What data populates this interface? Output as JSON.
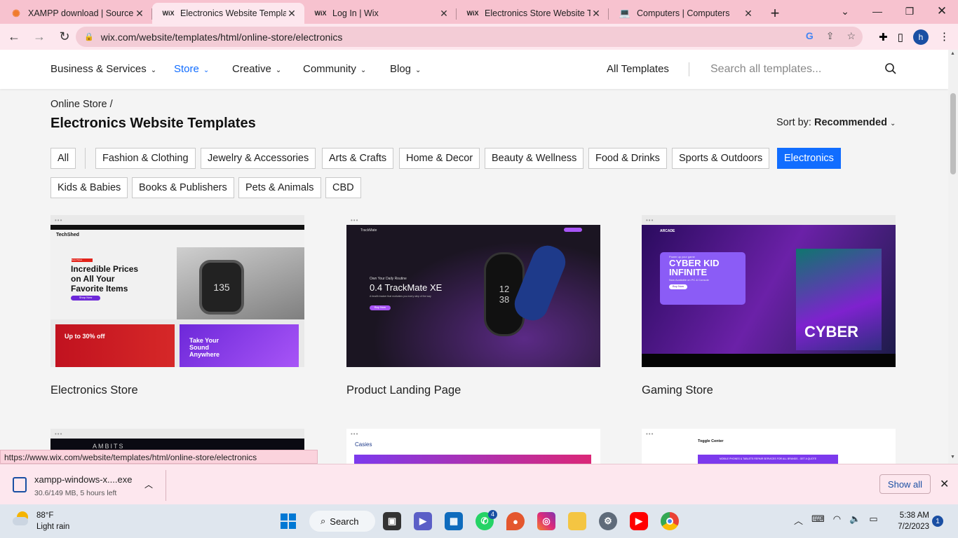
{
  "browser": {
    "tabs": [
      {
        "title": "XAMPP download | SourceFo",
        "favicon": "xampp-icon",
        "active": false
      },
      {
        "title": "Electronics Website Template",
        "favicon": "wix-icon",
        "active": true
      },
      {
        "title": "Log In | Wix",
        "favicon": "wix-icon",
        "active": false
      },
      {
        "title": "Electronics Store Website Ten",
        "favicon": "wix-icon",
        "active": false
      },
      {
        "title": "Computers | Computers",
        "favicon": "laptop-icon",
        "active": false
      }
    ],
    "url": "wix.com/website/templates/html/online-store/electronics",
    "profile_initial": "h",
    "status_url": "https://www.wix.com/website/templates/html/online-store/electronics"
  },
  "site_nav": {
    "items": [
      "Business & Services",
      "Store",
      "Creative",
      "Community",
      "Blog"
    ],
    "all_templates": "All Templates",
    "search_placeholder": "Search all templates..."
  },
  "page": {
    "breadcrumb": "Online Store /",
    "title": "Electronics Website Templates",
    "sort_label": "Sort by:",
    "sort_value": "Recommended"
  },
  "filters": {
    "row1": [
      "All",
      "Fashion & Clothing",
      "Jewelry & Accessories",
      "Arts & Crafts",
      "Home & Decor",
      "Beauty & Wellness",
      "Food & Drinks",
      "Sports & Outdoors",
      "Electronics"
    ],
    "row2": [
      "Kids & Babies",
      "Books & Publishers",
      "Pets & Animals",
      "CBD"
    ],
    "active": "Electronics"
  },
  "templates": [
    {
      "name": "Electronics Store",
      "brand": "TechShed",
      "headline": "Incredible Prices on All Your Favorite Items",
      "badge": "New Prices",
      "button": "Shop Now",
      "promo1": "Up to 30% off",
      "promo2": "Take Your Sound Anywhere"
    },
    {
      "name": "Product Landing Page",
      "brand": "TrackMate",
      "tagline": "Own Your Daily Routine",
      "headline": "0.4 TrackMate XE",
      "sub": "A health tracker that motivates you every step of the way",
      "button": "Buy Now"
    },
    {
      "name": "Gaming Store",
      "brand": "ARCADE",
      "tagline": "Power up your game",
      "headline": "CYBER KID INFINITE",
      "sub": "Now Available on PC & Console",
      "button": "Buy Now",
      "art_text": "CYBER"
    },
    {
      "name": "",
      "brand": "AMBITS"
    },
    {
      "name": "",
      "brand": "Casies"
    },
    {
      "name": "",
      "brand": "Toggle Center",
      "banner": "MOBILE PHONES & TABLETS REPAIR SERVICES FOR ALL BRANDS - GET A QUOTE"
    }
  ],
  "download": {
    "filename": "xampp-windows-x....exe",
    "status": "30.6/149 MB, 5 hours left",
    "show_all": "Show all"
  },
  "taskbar": {
    "temperature": "88°F",
    "weather": "Light rain",
    "search": "Search",
    "whatsapp_badge": "4",
    "time": "5:38 AM",
    "date": "7/2/2023",
    "notifications": "1"
  },
  "colors": {
    "accent": "#116dff",
    "browser_frame": "#f7c2cf",
    "toolbar": "#fde7ee"
  }
}
